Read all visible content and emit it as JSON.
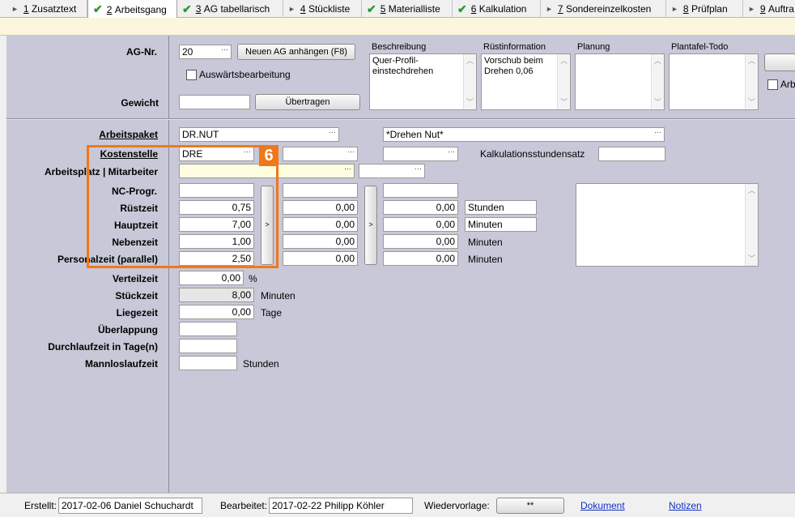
{
  "tabs": [
    {
      "prefix": "1",
      "label": "Zusatztext",
      "check": false
    },
    {
      "prefix": "2",
      "label": "Arbeitsgang",
      "check": true
    },
    {
      "prefix": "3",
      "label": "AG tabellarisch",
      "check": true
    },
    {
      "prefix": "4",
      "label": "Stückliste",
      "check": false
    },
    {
      "prefix": "5",
      "label": "Materialliste",
      "check": true
    },
    {
      "prefix": "6",
      "label": "Kalkulation",
      "check": true
    },
    {
      "prefix": "7",
      "label": "Sondereinzelkosten",
      "check": false
    },
    {
      "prefix": "8",
      "label": "Prüfplan",
      "check": false
    },
    {
      "prefix": "9",
      "label": "Auftra",
      "check": false
    }
  ],
  "top": {
    "ag_nr_label": "AG-Nr.",
    "ag_nr_value": "20",
    "new_ag_button": "Neuen AG anhängen (F8)",
    "auswaerts_label": "Auswärtsbearbeitung",
    "gewicht_label": "Gewicht",
    "gewicht_value": "",
    "uebertragen_button": "Übertragen",
    "beschreibung_label": "Beschreibung",
    "beschreibung_value": "Quer-Profil-\neinstechdrehen",
    "ruestinfo_label": "Rüstinformation",
    "ruestinfo_value": "Vorschub beim\nDrehen 0,06",
    "planung_label": "Planung",
    "plantafel_label": "Plantafel-Todo",
    "arb_checkbox_label": "Arb"
  },
  "form": {
    "arbeitspaket_label": "Arbeitspaket",
    "arbeitspaket_value": "DR.NUT",
    "arbeitspaket_desc": "*Drehen Nut*",
    "kostenstelle_label": "Kostenstelle",
    "kostenstelle_value": "DRE",
    "kalk_label": "Kalkulationsstundensatz",
    "arbeitsplatz_label": "Arbeitsplatz | Mitarbeiter",
    "nc_label": "NC-Progr.",
    "ruestzeit_label": "Rüstzeit",
    "hauptzeit_label": "Hauptzeit",
    "nebenzeit_label": "Nebenzeit",
    "personalzeit_label": "Personalzeit (parallel)",
    "col1": {
      "ruest": "0,75",
      "haupt": "7,00",
      "neben": "1,00",
      "personal": "2,50"
    },
    "col2": {
      "ruest": "0,00",
      "haupt": "0,00",
      "neben": "0,00",
      "personal": "0,00"
    },
    "col3": {
      "ruest": "0,00",
      "haupt": "0,00",
      "neben": "0,00",
      "personal": "0,00"
    },
    "units": {
      "ruest": "Stunden",
      "haupt": "Minuten",
      "neben": "Minuten",
      "personal": "Minuten"
    },
    "arrow": ">",
    "verteilzeit_label": "Verteilzeit",
    "verteilzeit_value": "0,00",
    "verteilzeit_unit": "%",
    "stueckzeit_label": "Stückzeit",
    "stueckzeit_value": "8,00",
    "stueckzeit_unit": "Minuten",
    "liegezeit_label": "Liegezeit",
    "liegezeit_value": "0,00",
    "liegezeit_unit": "Tage",
    "ueberlappung_label": "Überlappung",
    "durchlaufzeit_label": "Durchlaufzeit in Tage(n)",
    "mannlos_label": "Mannloslaufzeit",
    "mannlos_unit": "Stunden",
    "badge": "6"
  },
  "status": {
    "erstellt_label": "Erstellt:",
    "erstellt_value": "2017-02-06  Daniel Schuchardt",
    "bearbeitet_label": "Bearbeitet:",
    "bearbeitet_value": "2017-02-22  Philipp Köhler",
    "wiedervorlage_label": "Wiedervorlage:",
    "wiedervorlage_value": "**",
    "dokument_link": "Dokument",
    "notizen_link": "Notizen"
  },
  "colors": {
    "panel": "#c8c8d8",
    "highlight": "#f07818",
    "band": "#fbf6dc",
    "check": "#2a9a2a",
    "link": "#1030c0"
  }
}
